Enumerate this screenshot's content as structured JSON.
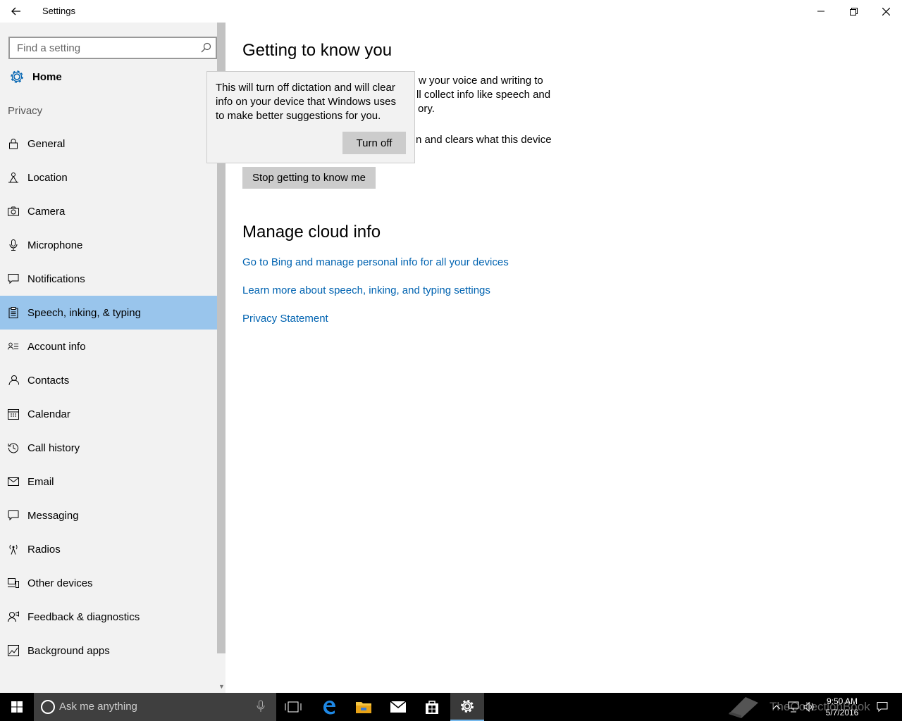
{
  "window": {
    "title": "Settings",
    "back_icon": "back-arrow-icon",
    "minimize_icon": "minimize-icon",
    "restore_icon": "restore-icon",
    "close_icon": "close-icon"
  },
  "sidebar": {
    "search_placeholder": "Find a setting",
    "home_label": "Home",
    "section_label": "Privacy",
    "items": [
      {
        "label": "General",
        "icon": "lock-icon"
      },
      {
        "label": "Location",
        "icon": "location-icon"
      },
      {
        "label": "Camera",
        "icon": "camera-icon"
      },
      {
        "label": "Microphone",
        "icon": "microphone-icon"
      },
      {
        "label": "Notifications",
        "icon": "notification-icon"
      },
      {
        "label": "Speech, inking, & typing",
        "icon": "clipboard-icon",
        "selected": true
      },
      {
        "label": "Account info",
        "icon": "account-info-icon"
      },
      {
        "label": "Contacts",
        "icon": "contacts-icon"
      },
      {
        "label": "Calendar",
        "icon": "calendar-icon"
      },
      {
        "label": "Call history",
        "icon": "history-icon"
      },
      {
        "label": "Email",
        "icon": "email-icon"
      },
      {
        "label": "Messaging",
        "icon": "messaging-icon"
      },
      {
        "label": "Radios",
        "icon": "radio-tower-icon"
      },
      {
        "label": "Other devices",
        "icon": "devices-icon"
      },
      {
        "label": "Feedback & diagnostics",
        "icon": "feedback-icon"
      },
      {
        "label": "Background apps",
        "icon": "background-apps-icon"
      }
    ]
  },
  "main": {
    "heading": "Getting to know you",
    "para1_line1": "w your voice and writing to",
    "para1_line2": "ll collect info like speech and",
    "para1_line3": "ory.",
    "para2_line1": "n and clears what this device",
    "stop_button": "Stop getting to know me",
    "cloud_heading": "Manage cloud info",
    "links": [
      "Go to Bing and manage personal info for all your devices",
      "Learn more about speech, inking, and typing settings",
      "Privacy Statement"
    ]
  },
  "flyout": {
    "message": "This will turn off dictation and will clear info on your device that Windows uses to make better suggestions for you.",
    "button": "Turn off"
  },
  "taskbar": {
    "search_placeholder": "Ask me anything",
    "time": "9:50 AM",
    "date": "5/7/2016",
    "watermark": "TheCollectionBook",
    "accent": "#76b9ed"
  },
  "colors": {
    "selected_bg": "#99c5ec",
    "link": "#0063b1",
    "sidebar_bg": "#f2f2f2"
  }
}
